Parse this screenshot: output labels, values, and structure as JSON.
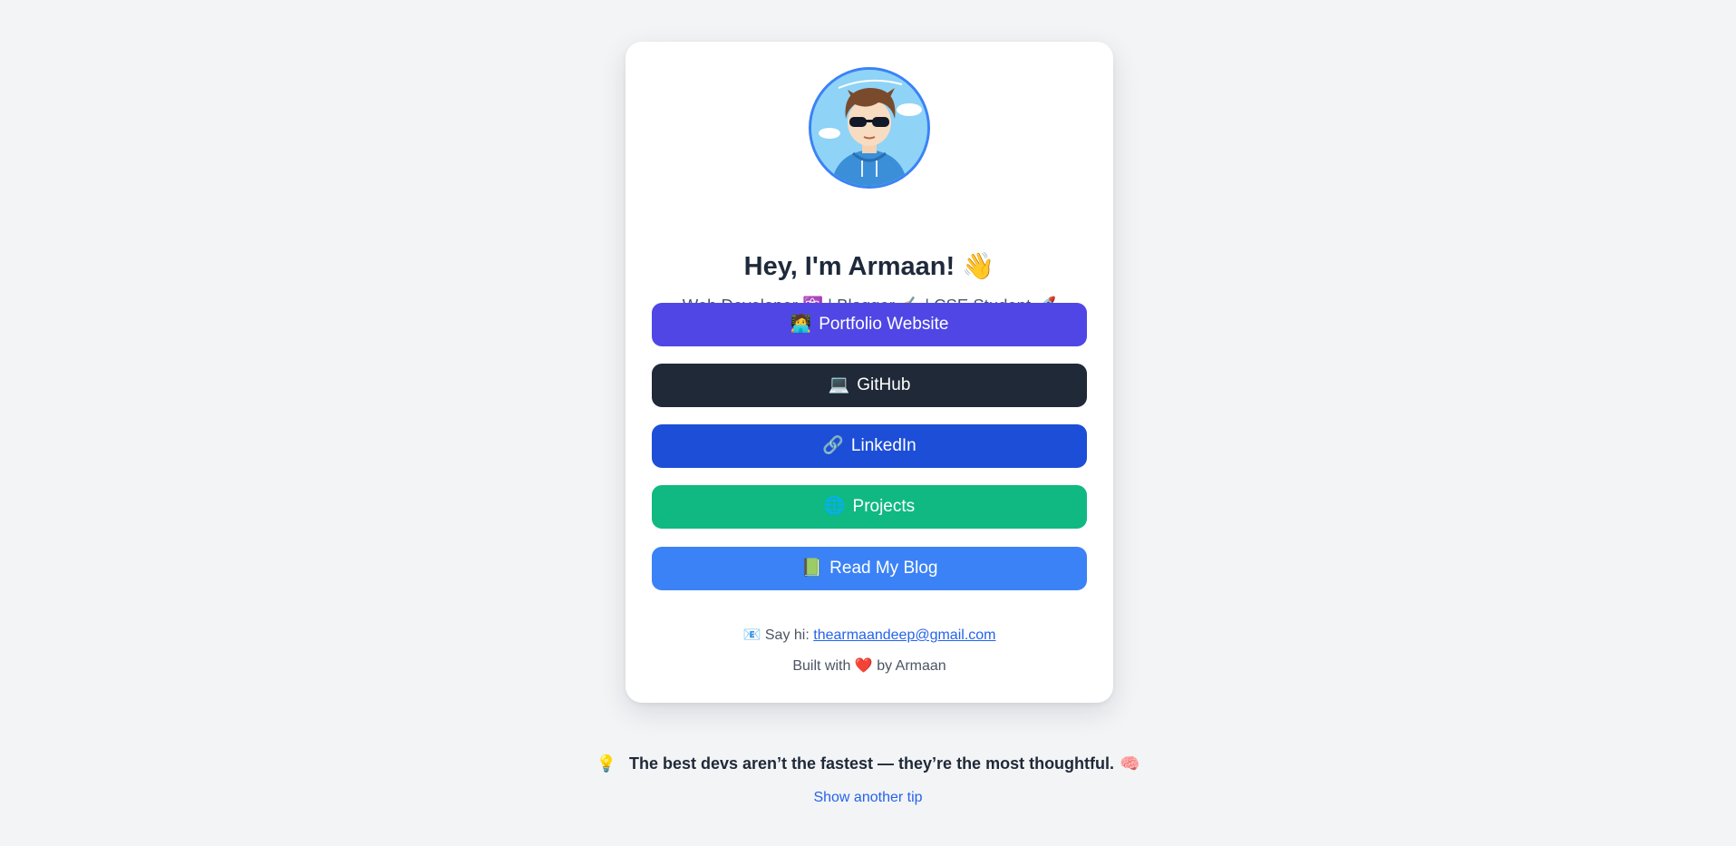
{
  "profile": {
    "name": "Hey, I'm Armaan! 👋",
    "tagline": "Web Developer ⚛️ | Blogger ✍️ | CSE Student 🚀",
    "avatar_alt": "cartoon-avatar-with-sunglasses"
  },
  "links": [
    {
      "emoji": "🧑‍💻",
      "label": "Portfolio Website",
      "color": "#4f46e5"
    },
    {
      "emoji": "💻",
      "label": "GitHub",
      "color": "#1f2937"
    },
    {
      "emoji": "🔗",
      "label": "LinkedIn",
      "color": "#1d4ed8"
    },
    {
      "emoji": "🌐",
      "label": "Projects",
      "color": "#10b981"
    },
    {
      "emoji": "📗",
      "label": "Read My Blog",
      "color": "#3b82f6"
    }
  ],
  "footer": {
    "contact_prefix": "📧 Say hi:",
    "email": "thearmaandeep@gmail.com",
    "built_prefix": "Built with",
    "heart": "❤️",
    "built_suffix": "by Armaan"
  },
  "tip": {
    "bulb": "💡",
    "text": "The best devs aren’t the fastest — they’re the most thoughtful.",
    "brain": "🧠",
    "next_label": "Show another tip"
  },
  "colors": {
    "page_bg": "#f3f4f6",
    "card_bg": "#ffffff",
    "accent_link": "#2563eb",
    "avatar_border": "#3b82f6"
  }
}
